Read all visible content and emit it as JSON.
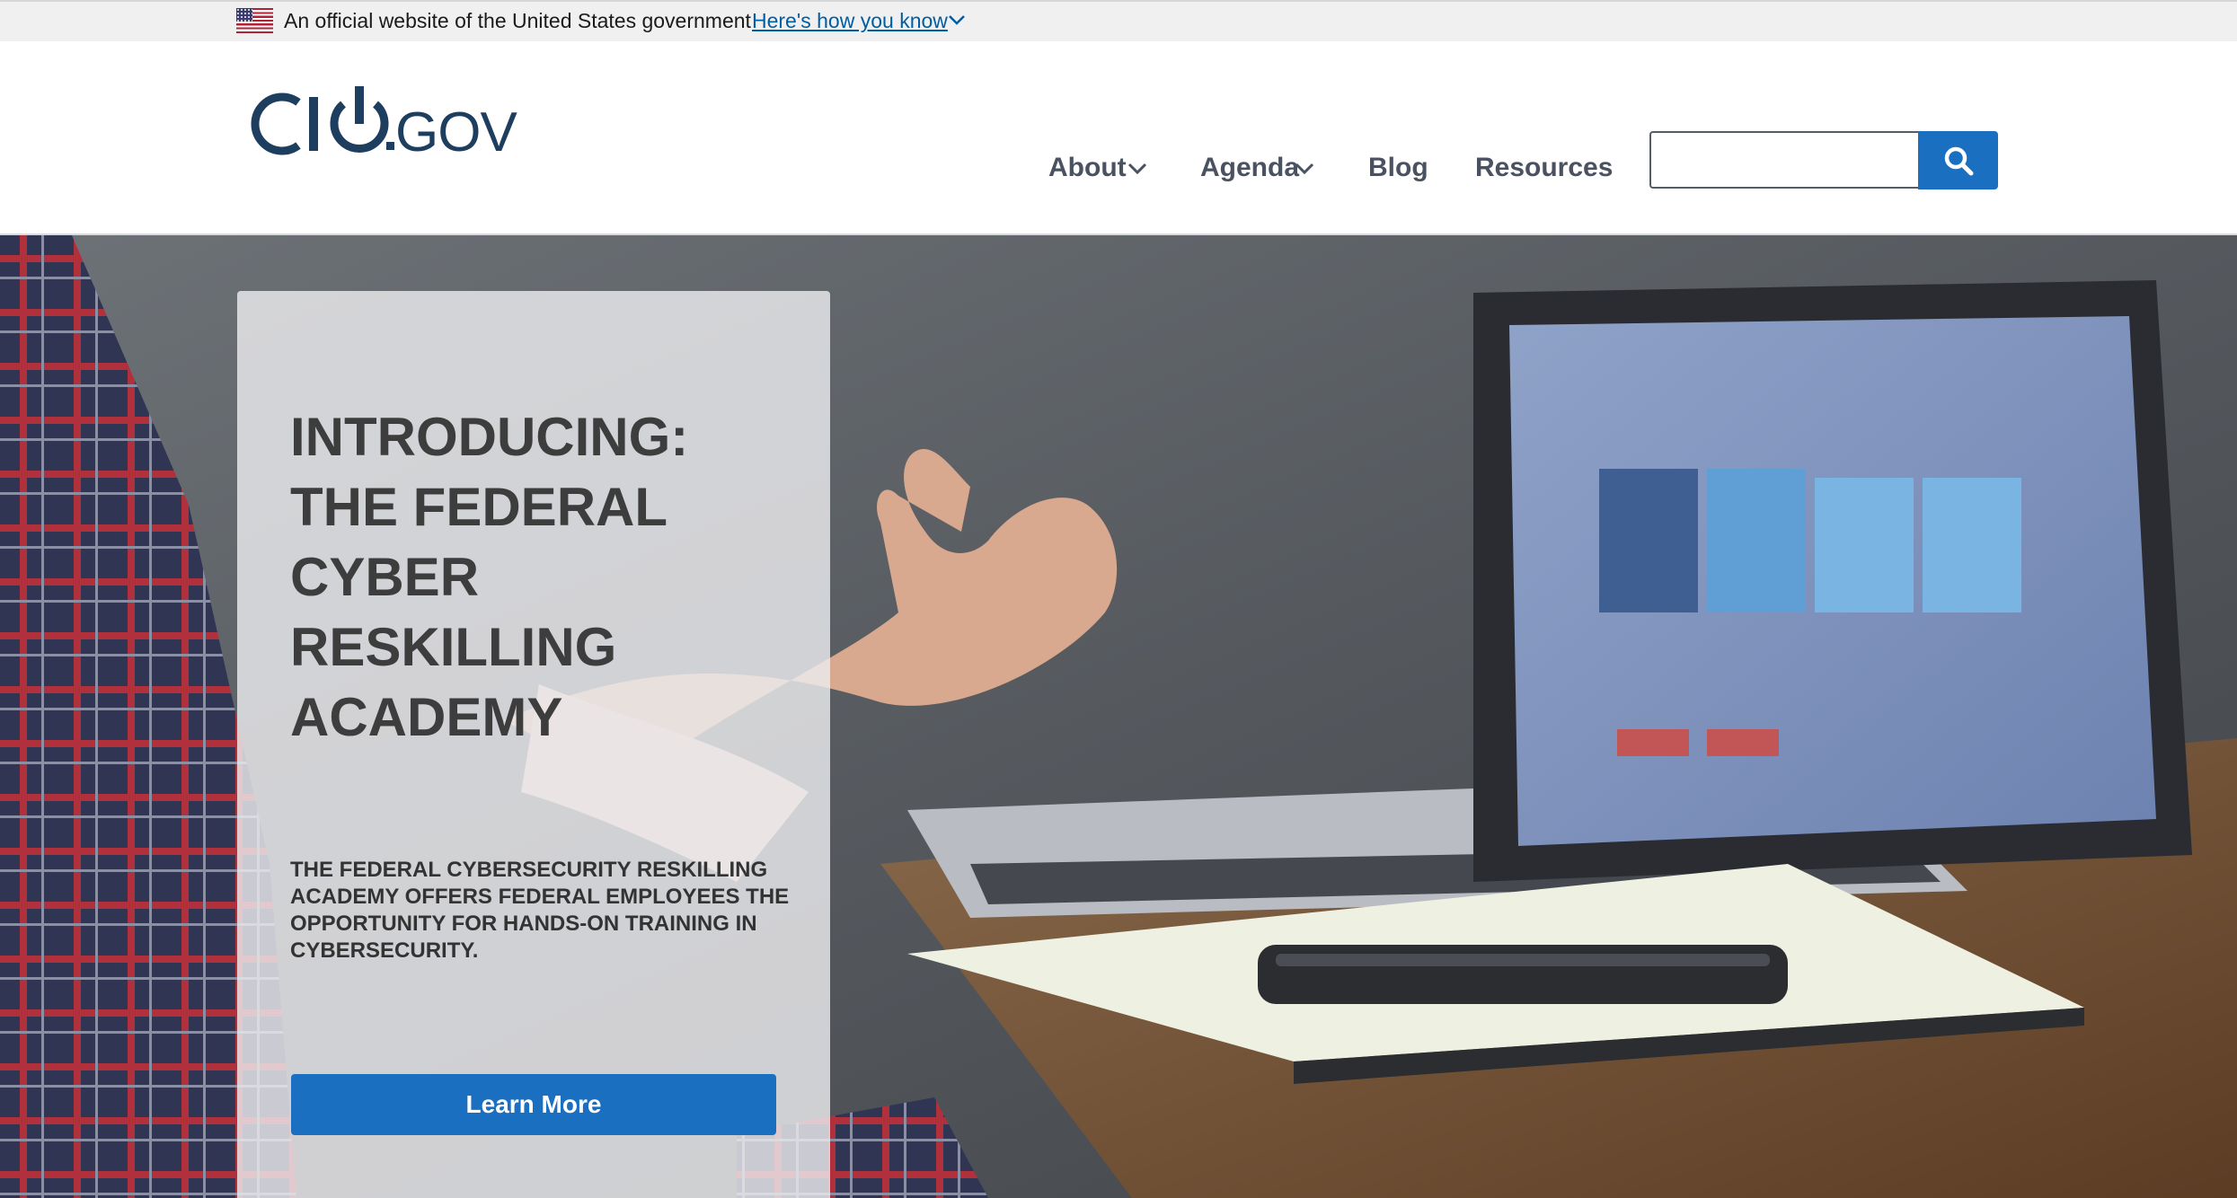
{
  "gov_banner": {
    "official_text": "An official website of the United States government",
    "how_link": "Here's how you know"
  },
  "header": {
    "logo_text": "CIO.GOV",
    "nav": {
      "about": "About",
      "agenda": "Agenda",
      "blog": "Blog",
      "resources": "Resources"
    },
    "search": {
      "value": "",
      "icon": "search-icon"
    }
  },
  "hero": {
    "title": "INTRODUCING:\nTHE FEDERAL\nCYBER\nRESKILLING\nACADEMY",
    "description": "THE FEDERAL CYBERSECURITY RESKILLING ACADEMY OFFERS FEDERAL EMPLOYEES THE OPPORTUNITY FOR HANDS-ON TRAINING IN CYBERSECURITY.",
    "button_label": "Learn More"
  },
  "colors": {
    "primary": "#1a6fc1",
    "logo": "#1d3e5e",
    "nav_text": "#4a5160",
    "link": "#005ea2"
  }
}
